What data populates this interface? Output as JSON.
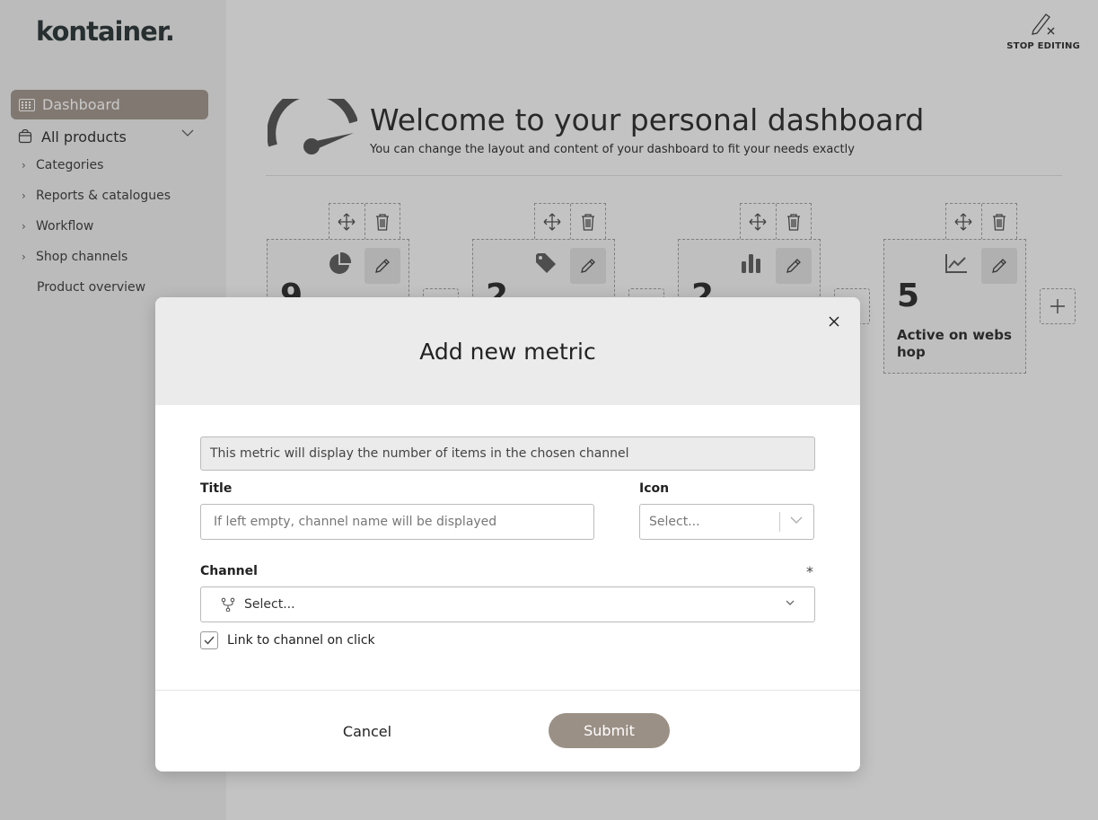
{
  "brand": {
    "logo_text": "kontainer."
  },
  "sidebar": {
    "dashboard_label": "Dashboard",
    "products_label": "All products",
    "items": [
      {
        "label": "Categories"
      },
      {
        "label": "Reports & catalogues"
      },
      {
        "label": "Workflow"
      },
      {
        "label": "Shop channels"
      },
      {
        "label": "Product overview"
      }
    ]
  },
  "header": {
    "stop_editing_label": "STOP EDITING",
    "title": "Welcome to your personal dashboard",
    "subtitle": "You can change the layout and content of your dashboard to fit your needs exactly"
  },
  "tiles": [
    {
      "icon": "pie-chart-icon",
      "value": "9",
      "label": ""
    },
    {
      "icon": "tag-icon",
      "value": "2",
      "label": ""
    },
    {
      "icon": "bar-chart-icon",
      "value": "2",
      "label": ""
    },
    {
      "icon": "line-chart-icon",
      "value": "5",
      "label": "Active on webshop"
    }
  ],
  "modal": {
    "title": "Add new metric",
    "info": "This metric will display the number of items in the chosen channel",
    "title_field": {
      "label": "Title",
      "placeholder": "If left empty, channel name will be displayed"
    },
    "icon_field": {
      "label": "Icon",
      "placeholder": "Select..."
    },
    "channel_field": {
      "label": "Channel",
      "required_mark": "*",
      "placeholder": "Select..."
    },
    "link_checkbox": {
      "label": "Link to channel on click",
      "checked": true
    },
    "cancel_label": "Cancel",
    "submit_label": "Submit"
  },
  "colors": {
    "accent": "#9b9086",
    "overlay": "rgba(60,60,60,0.28)"
  }
}
